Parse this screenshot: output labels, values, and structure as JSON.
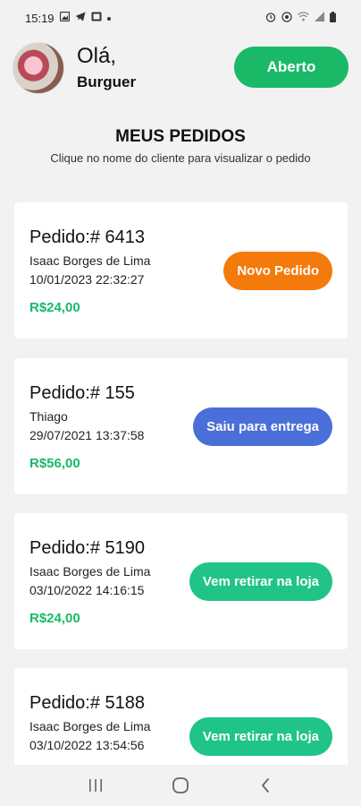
{
  "status_bar": {
    "time": "15:19",
    "left_icons": [
      "image-icon",
      "telegram-icon",
      "gallery-icon",
      "dot-icon"
    ],
    "right_icons": [
      "alarm-icon",
      "wireless-charging-icon",
      "wifi-icon",
      "signal-icon",
      "battery-icon"
    ]
  },
  "header": {
    "greeting": "Olá,",
    "store_name": "Burguer",
    "status_button": "Aberto"
  },
  "page": {
    "title": "MEUS PEDIDOS",
    "subtitle": "Clique no nome do cliente para visualizar o pedido"
  },
  "orders": [
    {
      "id": "Pedido:# 6413",
      "customer": "Isaac Borges de Lima",
      "date": "10/01/2023 22:32:27",
      "price": "R$24,00",
      "status": "Novo Pedido",
      "status_color": "#f47a0c"
    },
    {
      "id": "Pedido:# 155",
      "customer": "Thiago",
      "date": "29/07/2021 13:37:58",
      "price": "R$56,00",
      "status": "Saiu para entrega",
      "status_color": "#4a6fd8"
    },
    {
      "id": "Pedido:# 5190",
      "customer": "Isaac Borges de Lima",
      "date": "03/10/2022 14:16:15",
      "price": "R$24,00",
      "status": "Vem retirar na loja",
      "status_color": "#1fc486"
    },
    {
      "id": "Pedido:# 5188",
      "customer": "Isaac Borges de Lima",
      "date": "03/10/2022 13:54:56",
      "price": "",
      "status": "Vem retirar na loja",
      "status_color": "#1fc486"
    }
  ],
  "colors": {
    "accent": "#19b968",
    "background": "#f2f2f2",
    "card": "#ffffff"
  },
  "nav": [
    "recent-apps-icon",
    "home-icon",
    "back-icon"
  ]
}
